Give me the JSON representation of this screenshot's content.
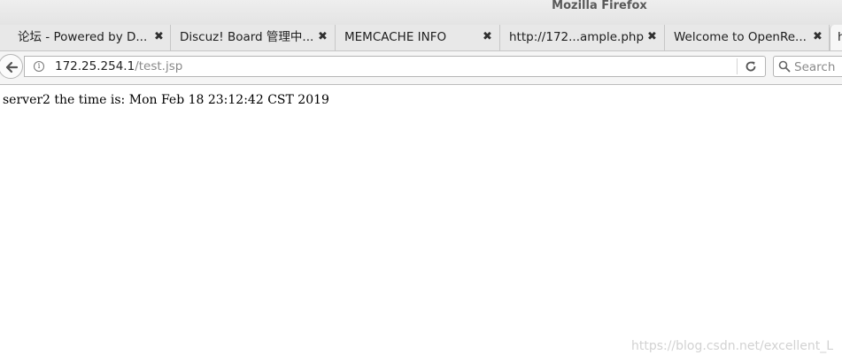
{
  "window": {
    "title": "Mozilla Firefox"
  },
  "tabs": [
    {
      "title": "论坛 - Powered by D...",
      "close": "✖"
    },
    {
      "title": "Discuz! Board 管理中...",
      "close": "✖"
    },
    {
      "title": "MEMCACHE INFO",
      "close": "✖"
    },
    {
      "title": "http://172...ample.php",
      "close": "✖"
    },
    {
      "title": "Welcome to OpenRe...",
      "close": "✖"
    },
    {
      "title": "h"
    }
  ],
  "navbar": {
    "url_host": "172.25.254.1",
    "url_path": "/test.jsp",
    "search_placeholder": "Search"
  },
  "page": {
    "text": "server2 the time is: Mon Feb 18 23:12:42 CST 2019"
  },
  "watermark": "https://blog.csdn.net/excellent_L"
}
